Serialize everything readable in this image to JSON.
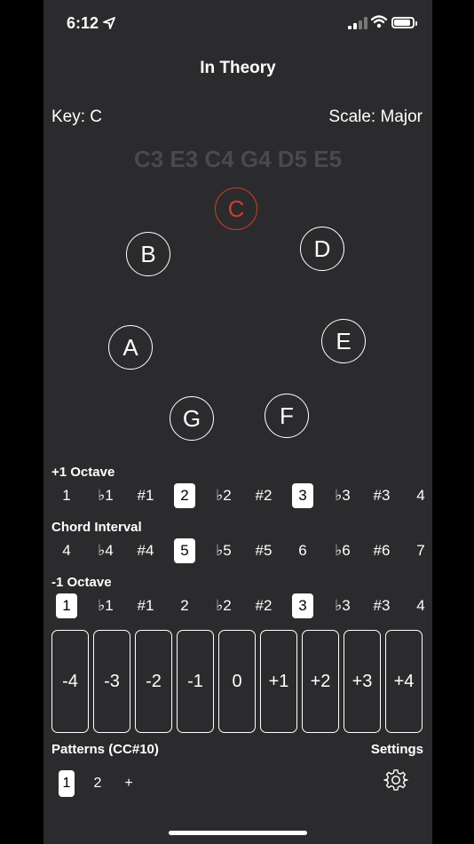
{
  "status_bar": {
    "time": "6:12",
    "icons": [
      "location-arrow-icon",
      "signal-icon",
      "wifi-icon",
      "battery-icon"
    ]
  },
  "header": {
    "title": "In Theory"
  },
  "key_label": "Key: C",
  "scale_label": "Scale: Major",
  "chord_notes": "C3 E3 C4 G4 D5 E5",
  "accent_color": "#d33a2c",
  "note_wheel": {
    "C": "C",
    "B": "B",
    "D": "D",
    "A": "A",
    "E": "E",
    "G": "G",
    "F": "F",
    "active": "C"
  },
  "plus_octave": {
    "label": "+1 Octave",
    "items": [
      "1",
      "♭1",
      "#1",
      "2",
      "♭2",
      "#2",
      "3",
      "♭3",
      "#3",
      "4"
    ],
    "selected": [
      "2",
      "3"
    ]
  },
  "chord_interval": {
    "label": "Chord Interval",
    "items": [
      "4",
      "♭4",
      "#4",
      "5",
      "♭5",
      "#5",
      "6",
      "♭6",
      "#6",
      "7"
    ],
    "selected": [
      "5"
    ]
  },
  "minus_octave": {
    "label": "-1 Octave",
    "items": [
      "1",
      "♭1",
      "#1",
      "2",
      "♭2",
      "#2",
      "3",
      "♭3",
      "#3",
      "4"
    ],
    "selected": [
      "1",
      "3"
    ]
  },
  "shift_buttons": [
    "-4",
    "-3",
    "-2",
    "-1",
    "0",
    "+1",
    "+2",
    "+3",
    "+4"
  ],
  "patterns": {
    "label": "Patterns (CC#10)",
    "items": [
      "1",
      "2"
    ],
    "selected": "1",
    "add_label": "+"
  },
  "settings": {
    "label": "Settings",
    "icon": "gear-icon"
  }
}
